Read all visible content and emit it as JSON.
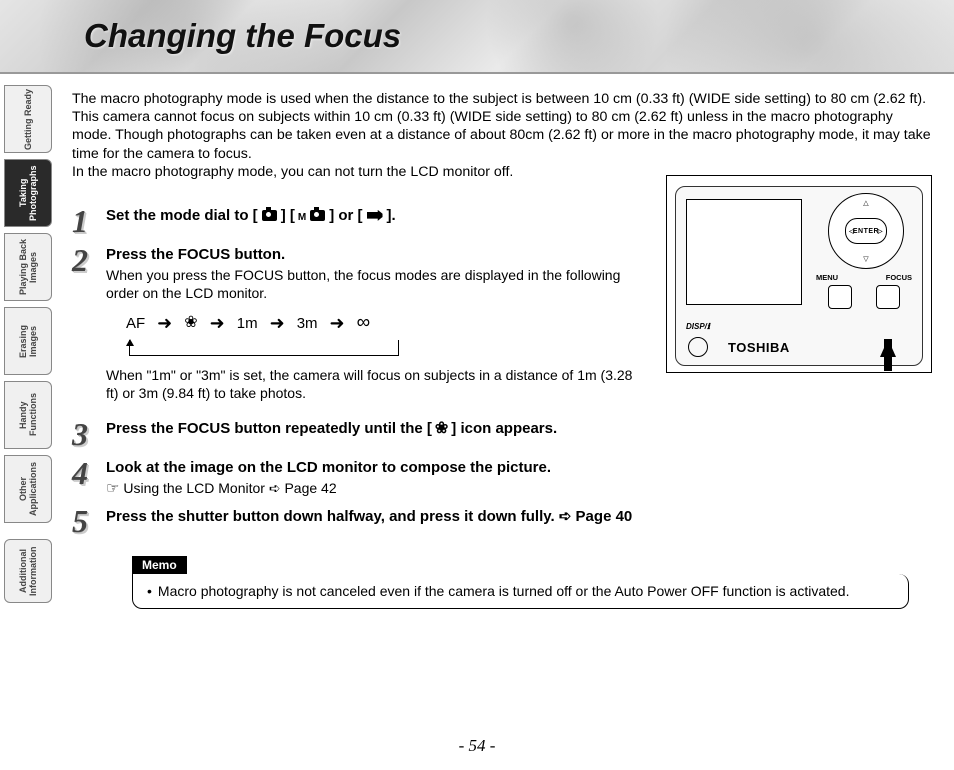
{
  "header": {
    "title": "Changing the Focus"
  },
  "sidebar": {
    "tabs": [
      {
        "label": "Getting Ready",
        "active": false
      },
      {
        "label": "Taking Photographs",
        "active": true
      },
      {
        "label": "Playing Back Images",
        "active": false
      },
      {
        "label": "Erasing Images",
        "active": false
      },
      {
        "label": "Handy Functions",
        "active": false
      },
      {
        "label": "Other Applications",
        "active": false
      },
      {
        "label": "Additional Information",
        "active": false
      }
    ]
  },
  "intro": "The macro photography mode is used when the distance to the subject is between 10 cm (0.33 ft) (WIDE side setting) to 80 cm (2.62 ft).\nThis camera cannot focus on subjects within 10 cm (0.33 ft) (WIDE side setting) to 80 cm (2.62 ft) unless in the macro photography mode. Though photographs can be taken even at a distance of about 80cm (2.62 ft) or more in the macro photography mode, it may take time for the camera to focus.\nIn the macro photography mode, you can not turn the LCD monitor off.",
  "steps": {
    "s1": {
      "title_a": "Set the mode dial to [",
      "title_b": "]  [",
      "title_c": "] or [",
      "title_d": "]."
    },
    "s2": {
      "title": "Press the FOCUS button.",
      "text1": "When you press the FOCUS button, the focus modes are displayed in the following order on the LCD monitor.",
      "text2": "When \"1m\" or \"3m\" is set, the camera will focus on subjects in a distance of 1m (3.28 ft) or 3m (9.84 ft) to take photos."
    },
    "s3": {
      "title_a": "Press the FOCUS button repeatedly until the [",
      "title_b": "] icon appears."
    },
    "s4": {
      "title": "Look at the image on the LCD monitor to compose the picture.",
      "link": "Using the LCD Monitor ➪ Page 42"
    },
    "s5": {
      "title": "Press the shutter button down halfway, and press it down fully. ➪ Page 40"
    }
  },
  "focus_flow": {
    "items": [
      "AF",
      "➜",
      "❀",
      "➜",
      "1m",
      "➜",
      "3m",
      "➜",
      "∞"
    ]
  },
  "device": {
    "enter": "ENTER",
    "menu": "MENU",
    "focus": "FOCUS",
    "disp": "DISP/ℹ",
    "brand": "TOSHIBA"
  },
  "memo": {
    "label": "Memo",
    "text": "Macro photography is not canceled even if the camera is turned off or the Auto Power OFF function is activated."
  },
  "page_number": "- 54 -"
}
